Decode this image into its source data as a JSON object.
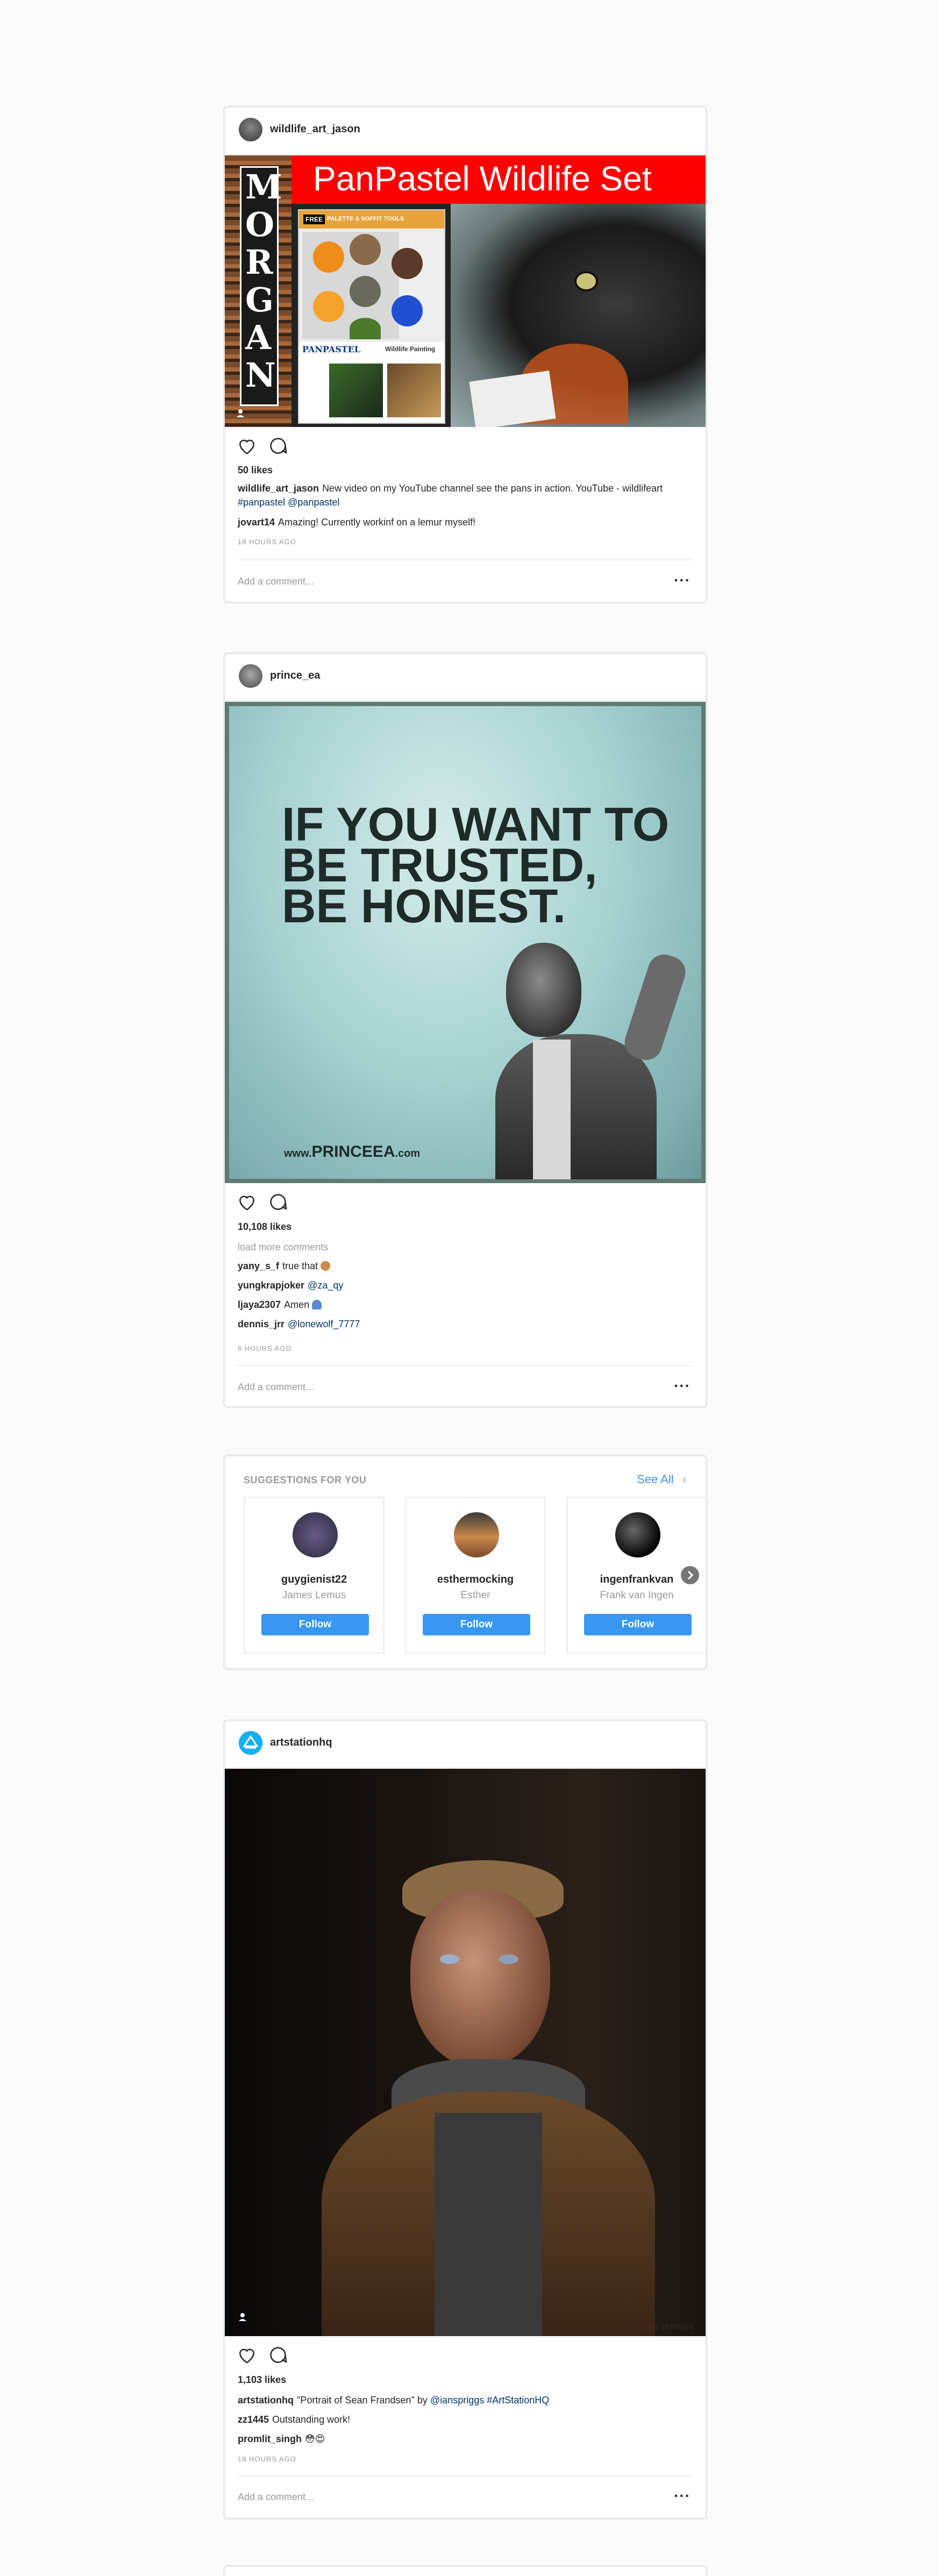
{
  "posts": [
    {
      "username": "wildlife_art_jason",
      "image": {
        "banner": "PanPastel Wildlife Set",
        "side_text": "MORGAN",
        "box_free": "FREE",
        "box_free_text": "PALETTE & SOFFIT TOOLS",
        "box_brand": "PANPASTEL",
        "box_subtitle": "Wildlife Painting"
      },
      "likes": "50 likes",
      "comments": [
        {
          "user": "wildlife_art_jason",
          "text": "New video on my YouTube channel see the pans in action. YouTube - wildlifeart",
          "tags": "#panpastel @panpastel"
        },
        {
          "user": "jovart14",
          "text": "Amazing! Currently workinf on a lemur myself!"
        }
      ],
      "time": "18 HOURS AGO",
      "add_comment": "Add a comment..."
    },
    {
      "username": "prince_ea",
      "image": {
        "line1": "IF YOU WANT TO",
        "line2": "BE TRUSTED,",
        "line3": "BE HONEST.",
        "site_prefix": "www.",
        "site_main": "PRINCEEA",
        "site_suffix": ".com"
      },
      "likes": "10,108 likes",
      "load_more": "load more comments",
      "comments": [
        {
          "user": "yany_s_f",
          "text": "true that"
        },
        {
          "user": "yungkrapjoker",
          "text": "@za_qy"
        },
        {
          "user": "ljaya2307",
          "text": "Amen"
        },
        {
          "user": "dennis_jrr",
          "text": "@lonewolf_7777"
        }
      ],
      "time": "8 HOURS AGO",
      "add_comment": "Add a comment..."
    },
    {
      "username": "artstationhq",
      "image": {
        "watermark": "IAN SPRIGGS"
      },
      "likes": "1,103 likes",
      "comments": [
        {
          "user": "artstationhq",
          "text": "\"Portrait of Sean Frandsen\" by",
          "tags": "@ianspriggs #ArtStationHQ"
        },
        {
          "user": "zz1445",
          "text": "Outstanding work!"
        },
        {
          "user": "promlit_singh",
          "text": "😳😍"
        }
      ],
      "time": "18 HOURS AGO",
      "add_comment": "Add a comment..."
    }
  ],
  "suggestions": {
    "title": "SUGGESTIONS FOR YOU",
    "see_all": "See All",
    "chevron": "›",
    "follow_label": "Follow",
    "users": [
      {
        "username": "guygienist22",
        "name": "James Lemus"
      },
      {
        "username": "esthermocking",
        "name": "Esther"
      },
      {
        "username": "ingenfrankvan",
        "name": "Frank van Ingen"
      }
    ]
  },
  "icons": {
    "heart": "heart-icon",
    "comment": "comment-icon",
    "more": "more-options-icon",
    "next": "chevron-right-icon",
    "user_tag": "user-tag-icon"
  },
  "colors": {
    "accent": "#3897f0",
    "link": "#003569",
    "muted": "#999999",
    "banner_red": "#ff0000"
  }
}
